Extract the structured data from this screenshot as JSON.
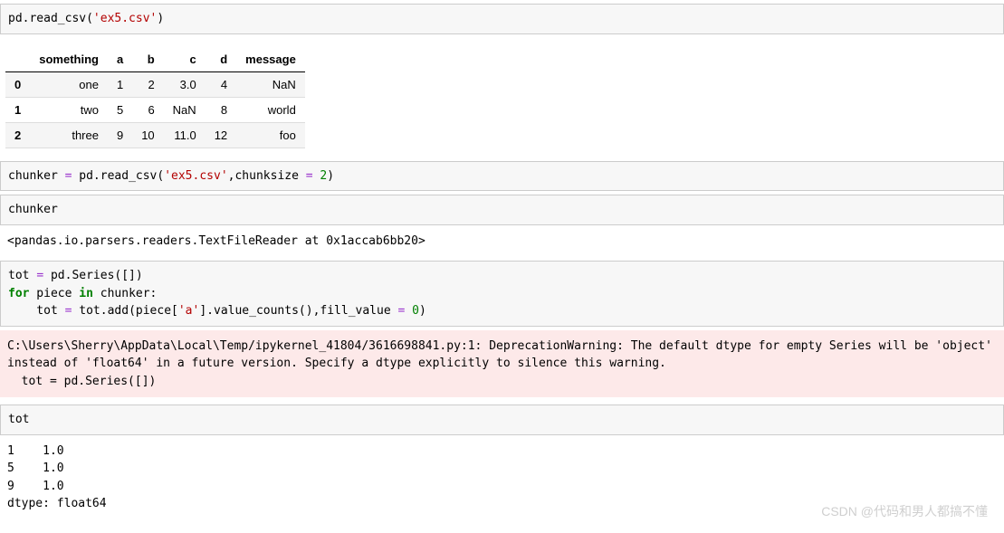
{
  "cell1": {
    "fn": "pd.read_csv(",
    "arg": "'ex5.csv'",
    "close": ")"
  },
  "table": {
    "headers": [
      "",
      "something",
      "a",
      "b",
      "c",
      "d",
      "message"
    ],
    "rows": [
      [
        "0",
        "one",
        "1",
        "2",
        "3.0",
        "4",
        "NaN"
      ],
      [
        "1",
        "two",
        "5",
        "6",
        "NaN",
        "8",
        "world"
      ],
      [
        "2",
        "three",
        "9",
        "10",
        "11.0",
        "12",
        "foo"
      ]
    ]
  },
  "cell2": {
    "p1": "chunker ",
    "eq": "=",
    "p2": " pd.read_csv(",
    "arg": "'ex5.csv'",
    "p3": ",chunksize ",
    "eq2": "=",
    "p4": " ",
    "num": "2",
    "p5": ")"
  },
  "cell3": {
    "text": "chunker"
  },
  "out3": {
    "text": "<pandas.io.parsers.readers.TextFileReader at 0x1accab6bb20>"
  },
  "cell4": {
    "l1a": "tot ",
    "l1eq": "=",
    "l1b": " pd.Series([])",
    "l2for": "for",
    "l2a": " piece ",
    "l2in": "in",
    "l2b": " chunker:",
    "l3a": "    tot ",
    "l3eq": "=",
    "l3b": " tot.add(piece[",
    "l3str": "'a'",
    "l3c": "].value_counts(),fill_value ",
    "l3eq2": "=",
    "l3d": " ",
    "l3num": "0",
    "l3e": ")"
  },
  "warning": {
    "text": "C:\\Users\\Sherry\\AppData\\Local\\Temp/ipykernel_41804/3616698841.py:1: DeprecationWarning: The default dtype for empty Series will be 'object' instead of 'float64' in a future version. Specify a dtype explicitly to silence this warning.\n  tot = pd.Series([])"
  },
  "cell5": {
    "text": "tot"
  },
  "out5": {
    "text": "1    1.0\n5    1.0\n9    1.0\ndtype: float64"
  },
  "watermark": "CSDN @代码和男人都搞不懂",
  "chart_data": {
    "type": "table",
    "title": "",
    "columns": [
      "something",
      "a",
      "b",
      "c",
      "d",
      "message"
    ],
    "index": [
      0,
      1,
      2
    ],
    "rows": [
      {
        "something": "one",
        "a": 1,
        "b": 2,
        "c": 3.0,
        "d": 4,
        "message": "NaN"
      },
      {
        "something": "two",
        "a": 5,
        "b": 6,
        "c": "NaN",
        "d": 8,
        "message": "world"
      },
      {
        "something": "three",
        "a": 9,
        "b": 10,
        "c": 11.0,
        "d": 12,
        "message": "foo"
      }
    ]
  }
}
